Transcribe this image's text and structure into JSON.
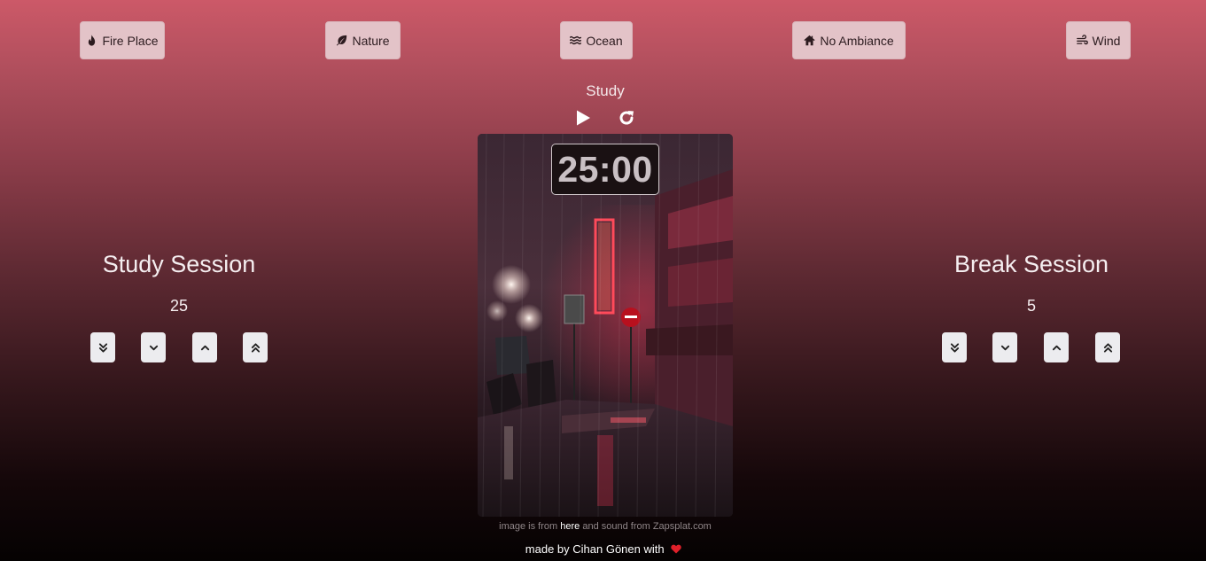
{
  "ambience": [
    {
      "label": "Fire Place",
      "icon": "fire-icon"
    },
    {
      "label": "Nature",
      "icon": "leaf-icon"
    },
    {
      "label": "Ocean",
      "icon": "water-icon"
    },
    {
      "label": "No Ambiance",
      "icon": "home-icon"
    },
    {
      "label": "Wind",
      "icon": "wind-icon"
    }
  ],
  "timer": {
    "mode": "Study",
    "display": "25:00",
    "play_icon": "play-icon",
    "reset_icon": "redo-icon"
  },
  "study": {
    "title": "Study Session",
    "value": "25"
  },
  "break": {
    "title": "Break Session",
    "value": "5"
  },
  "adjust_icons": [
    "double-chevron-down-icon",
    "chevron-down-icon",
    "chevron-up-icon",
    "double-chevron-up-icon"
  ],
  "footer": {
    "credit_prefix": "image is from",
    "credit_link": "here",
    "credit_suffix": "and sound from Zapsplat.com",
    "made_by": "made by Cihan Gönen with",
    "heart_color": "#e0202a"
  },
  "colors": {
    "button_bg": "#e3c3c8",
    "gradient_top": "#cc5968",
    "gradient_bottom": "#050202"
  }
}
